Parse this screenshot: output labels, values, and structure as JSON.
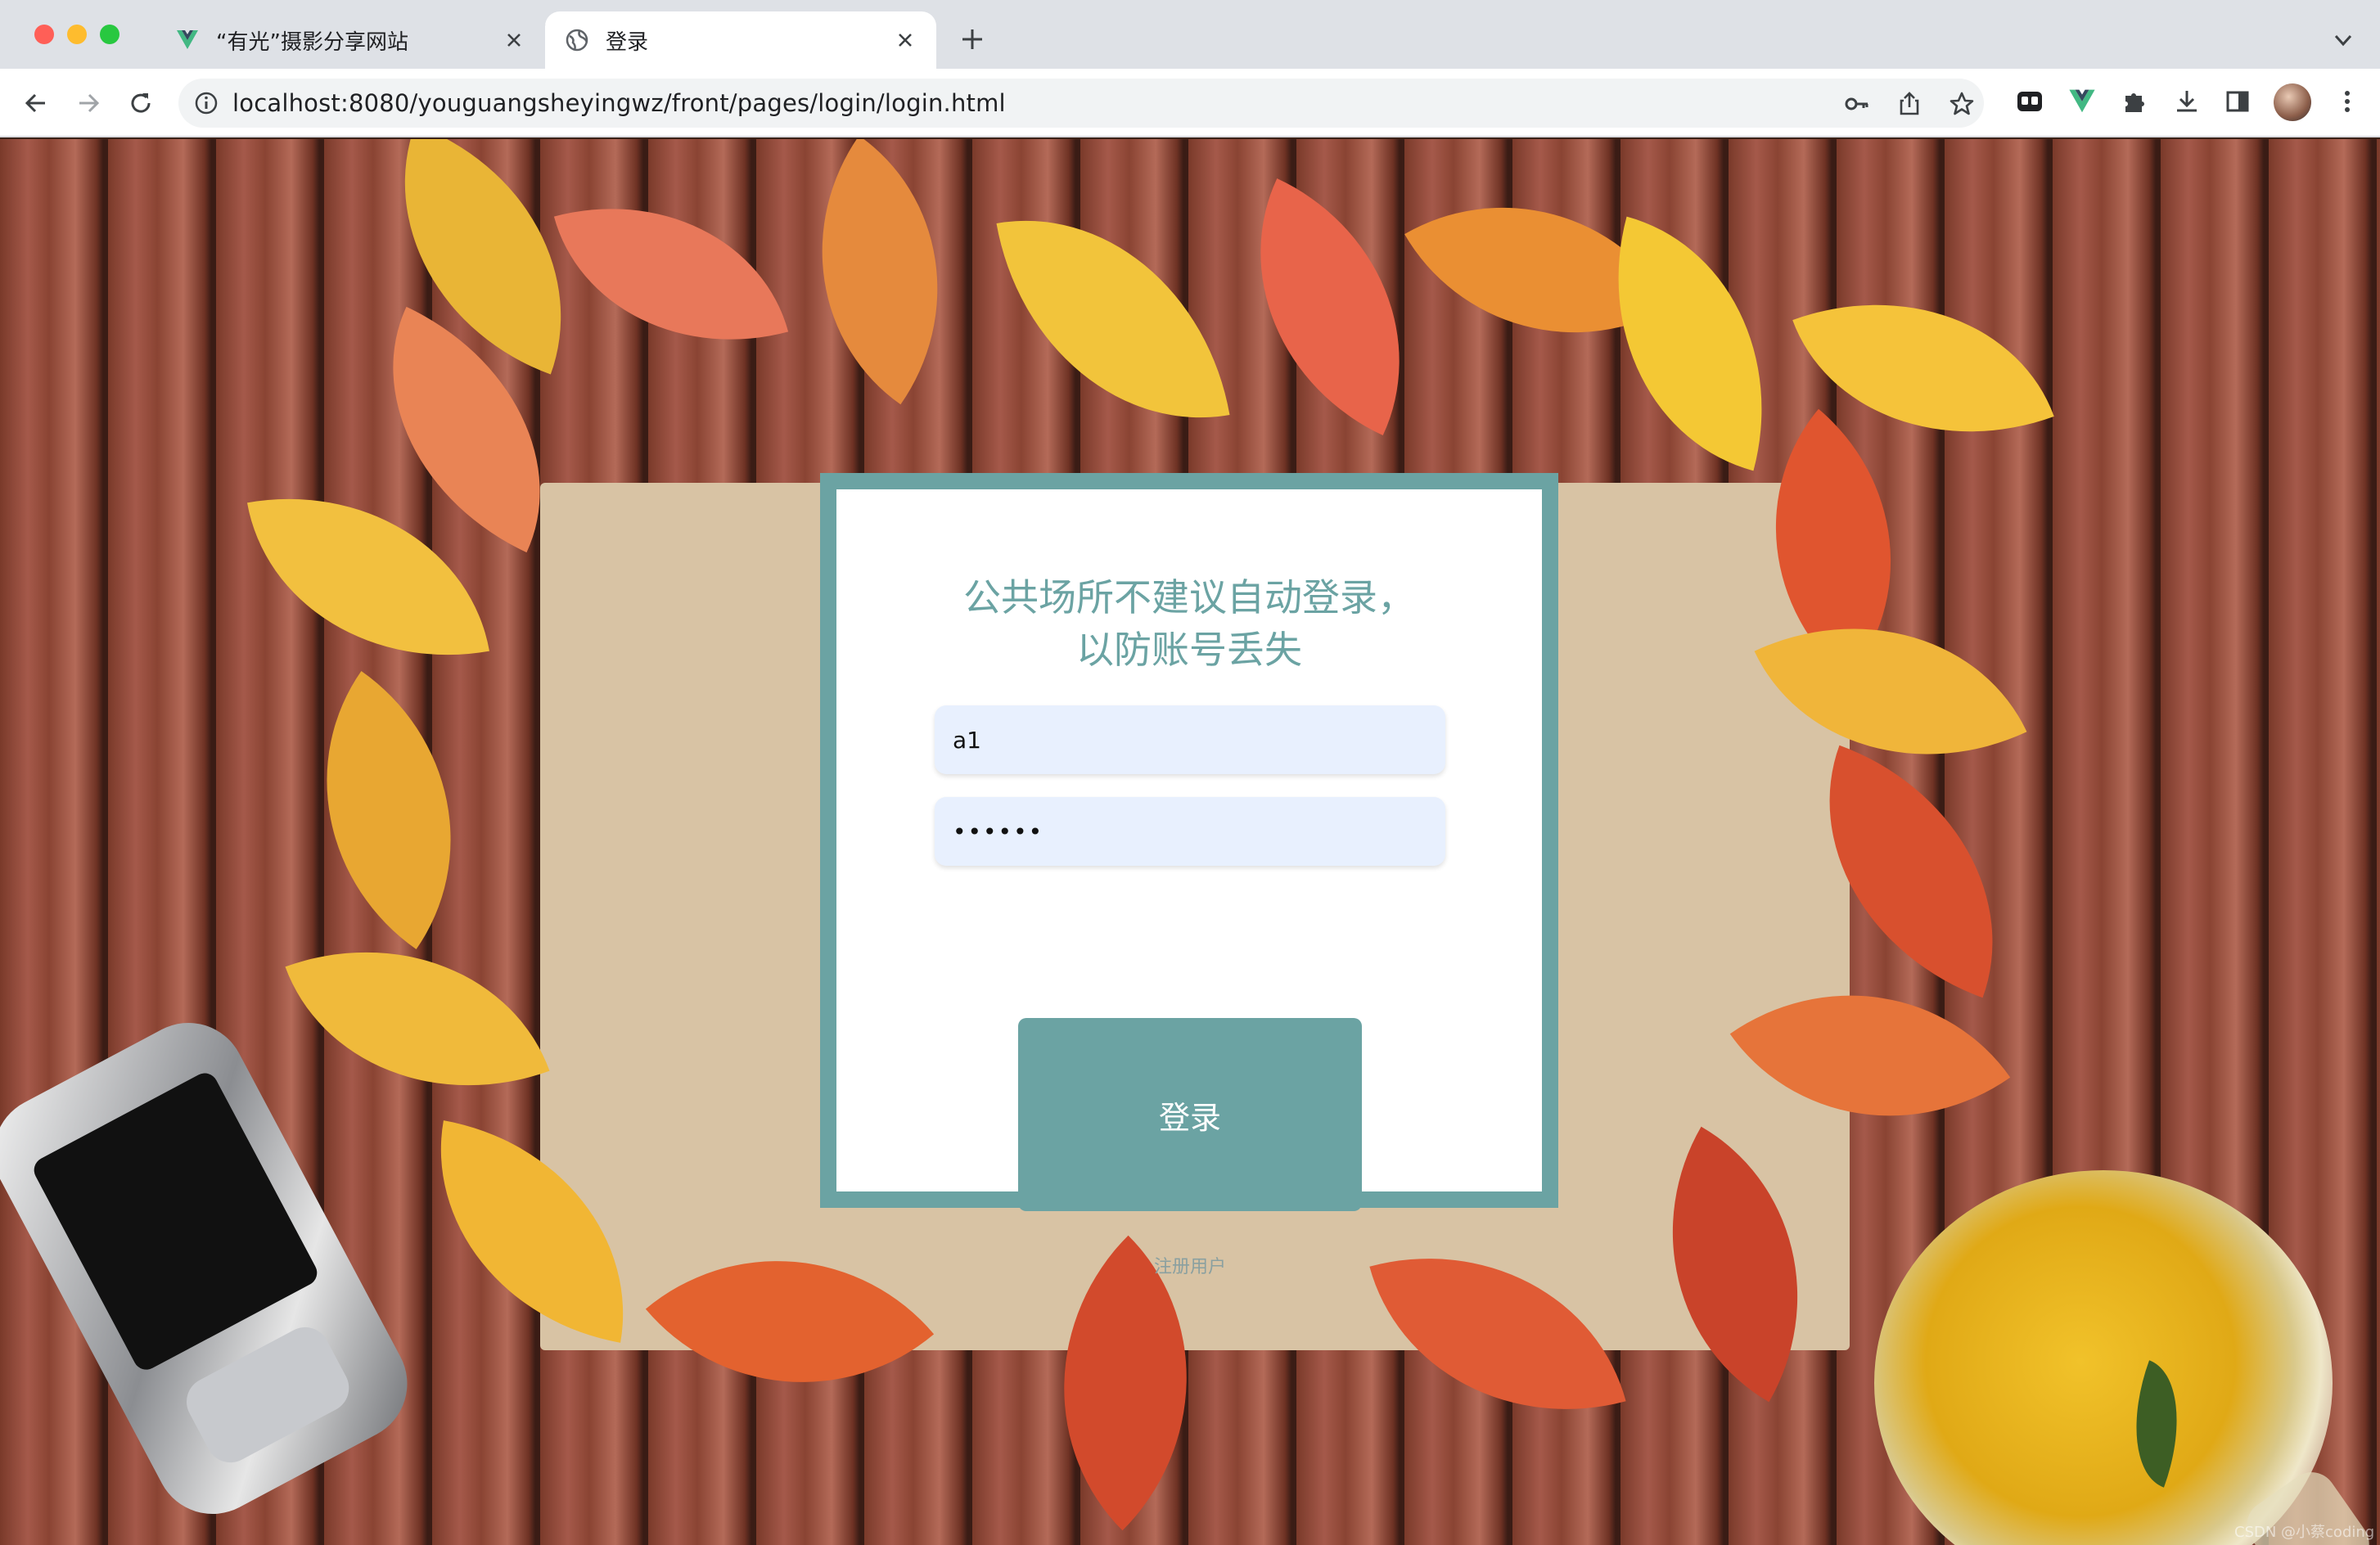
{
  "browser": {
    "tabs": [
      {
        "title": "“有光”摄影分享网站",
        "active": false
      },
      {
        "title": "登录",
        "active": true
      }
    ],
    "url": "localhost:8080/youguangsheyingwz/front/pages/login/login.html"
  },
  "colors": {
    "accent": "#6ba3a3",
    "input_bg": "#e8f0fe"
  },
  "login": {
    "title": "公共场所不建议自动登录，\n以防账号丢失",
    "username_value": "a1",
    "password_value": "••••••",
    "submit_label": "登录",
    "register_label": "注册用户"
  },
  "watermark": "CSDN @小蔡coding"
}
